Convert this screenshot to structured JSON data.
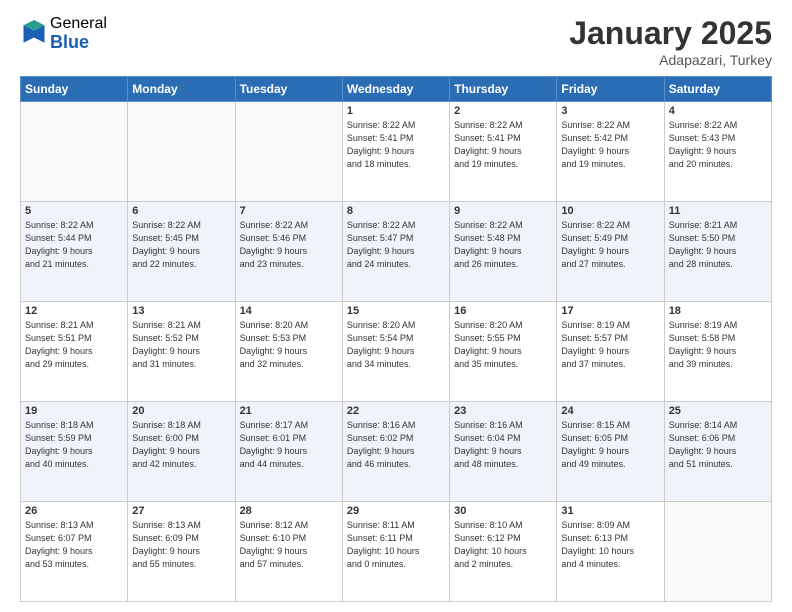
{
  "logo": {
    "general": "General",
    "blue": "Blue"
  },
  "title": "January 2025",
  "location": "Adapazari, Turkey",
  "days_of_week": [
    "Sunday",
    "Monday",
    "Tuesday",
    "Wednesday",
    "Thursday",
    "Friday",
    "Saturday"
  ],
  "weeks": [
    [
      {
        "day": "",
        "info": ""
      },
      {
        "day": "",
        "info": ""
      },
      {
        "day": "",
        "info": ""
      },
      {
        "day": "1",
        "info": "Sunrise: 8:22 AM\nSunset: 5:41 PM\nDaylight: 9 hours\nand 18 minutes."
      },
      {
        "day": "2",
        "info": "Sunrise: 8:22 AM\nSunset: 5:41 PM\nDaylight: 9 hours\nand 19 minutes."
      },
      {
        "day": "3",
        "info": "Sunrise: 8:22 AM\nSunset: 5:42 PM\nDaylight: 9 hours\nand 19 minutes."
      },
      {
        "day": "4",
        "info": "Sunrise: 8:22 AM\nSunset: 5:43 PM\nDaylight: 9 hours\nand 20 minutes."
      }
    ],
    [
      {
        "day": "5",
        "info": "Sunrise: 8:22 AM\nSunset: 5:44 PM\nDaylight: 9 hours\nand 21 minutes."
      },
      {
        "day": "6",
        "info": "Sunrise: 8:22 AM\nSunset: 5:45 PM\nDaylight: 9 hours\nand 22 minutes."
      },
      {
        "day": "7",
        "info": "Sunrise: 8:22 AM\nSunset: 5:46 PM\nDaylight: 9 hours\nand 23 minutes."
      },
      {
        "day": "8",
        "info": "Sunrise: 8:22 AM\nSunset: 5:47 PM\nDaylight: 9 hours\nand 24 minutes."
      },
      {
        "day": "9",
        "info": "Sunrise: 8:22 AM\nSunset: 5:48 PM\nDaylight: 9 hours\nand 26 minutes."
      },
      {
        "day": "10",
        "info": "Sunrise: 8:22 AM\nSunset: 5:49 PM\nDaylight: 9 hours\nand 27 minutes."
      },
      {
        "day": "11",
        "info": "Sunrise: 8:21 AM\nSunset: 5:50 PM\nDaylight: 9 hours\nand 28 minutes."
      }
    ],
    [
      {
        "day": "12",
        "info": "Sunrise: 8:21 AM\nSunset: 5:51 PM\nDaylight: 9 hours\nand 29 minutes."
      },
      {
        "day": "13",
        "info": "Sunrise: 8:21 AM\nSunset: 5:52 PM\nDaylight: 9 hours\nand 31 minutes."
      },
      {
        "day": "14",
        "info": "Sunrise: 8:20 AM\nSunset: 5:53 PM\nDaylight: 9 hours\nand 32 minutes."
      },
      {
        "day": "15",
        "info": "Sunrise: 8:20 AM\nSunset: 5:54 PM\nDaylight: 9 hours\nand 34 minutes."
      },
      {
        "day": "16",
        "info": "Sunrise: 8:20 AM\nSunset: 5:55 PM\nDaylight: 9 hours\nand 35 minutes."
      },
      {
        "day": "17",
        "info": "Sunrise: 8:19 AM\nSunset: 5:57 PM\nDaylight: 9 hours\nand 37 minutes."
      },
      {
        "day": "18",
        "info": "Sunrise: 8:19 AM\nSunset: 5:58 PM\nDaylight: 9 hours\nand 39 minutes."
      }
    ],
    [
      {
        "day": "19",
        "info": "Sunrise: 8:18 AM\nSunset: 5:59 PM\nDaylight: 9 hours\nand 40 minutes."
      },
      {
        "day": "20",
        "info": "Sunrise: 8:18 AM\nSunset: 6:00 PM\nDaylight: 9 hours\nand 42 minutes."
      },
      {
        "day": "21",
        "info": "Sunrise: 8:17 AM\nSunset: 6:01 PM\nDaylight: 9 hours\nand 44 minutes."
      },
      {
        "day": "22",
        "info": "Sunrise: 8:16 AM\nSunset: 6:02 PM\nDaylight: 9 hours\nand 46 minutes."
      },
      {
        "day": "23",
        "info": "Sunrise: 8:16 AM\nSunset: 6:04 PM\nDaylight: 9 hours\nand 48 minutes."
      },
      {
        "day": "24",
        "info": "Sunrise: 8:15 AM\nSunset: 6:05 PM\nDaylight: 9 hours\nand 49 minutes."
      },
      {
        "day": "25",
        "info": "Sunrise: 8:14 AM\nSunset: 6:06 PM\nDaylight: 9 hours\nand 51 minutes."
      }
    ],
    [
      {
        "day": "26",
        "info": "Sunrise: 8:13 AM\nSunset: 6:07 PM\nDaylight: 9 hours\nand 53 minutes."
      },
      {
        "day": "27",
        "info": "Sunrise: 8:13 AM\nSunset: 6:09 PM\nDaylight: 9 hours\nand 55 minutes."
      },
      {
        "day": "28",
        "info": "Sunrise: 8:12 AM\nSunset: 6:10 PM\nDaylight: 9 hours\nand 57 minutes."
      },
      {
        "day": "29",
        "info": "Sunrise: 8:11 AM\nSunset: 6:11 PM\nDaylight: 10 hours\nand 0 minutes."
      },
      {
        "day": "30",
        "info": "Sunrise: 8:10 AM\nSunset: 6:12 PM\nDaylight: 10 hours\nand 2 minutes."
      },
      {
        "day": "31",
        "info": "Sunrise: 8:09 AM\nSunset: 6:13 PM\nDaylight: 10 hours\nand 4 minutes."
      },
      {
        "day": "",
        "info": ""
      }
    ]
  ]
}
